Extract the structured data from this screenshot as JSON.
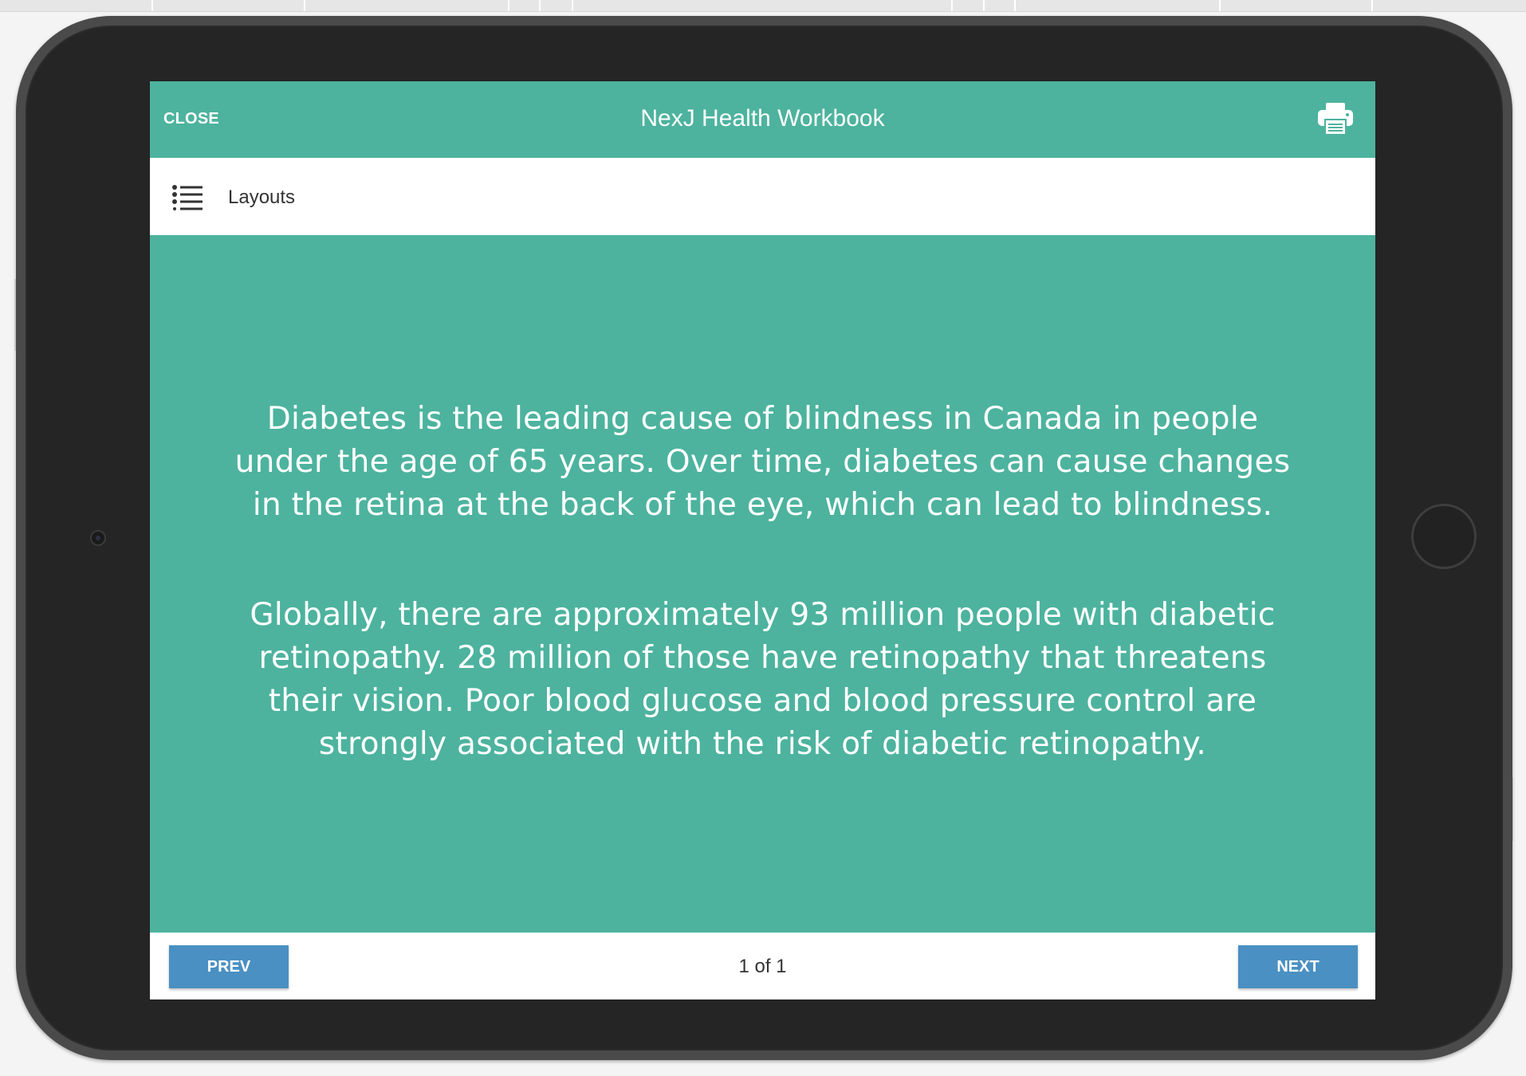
{
  "header": {
    "close_label": "CLOSE",
    "title": "NexJ Health Workbook",
    "print_icon": "printer-icon"
  },
  "subheader": {
    "menu_icon": "list-icon",
    "label": "Layouts"
  },
  "content": {
    "paragraph_1": "Diabetes is the leading cause of blindness in Canada in people under the age of 65 years. Over time, diabetes can cause changes in the retina at the back of the eye, which can lead to blindness.",
    "paragraph_2": "Globally, there are approximately 93 million people with diabetic retinopathy. 28 million of those have retinopathy that threatens their vision.  Poor blood glucose and blood pressure control are strongly associated with the risk of diabetic retinopathy."
  },
  "footer": {
    "prev_label": "PREV",
    "page_indicator": "1 of 1",
    "next_label": "NEXT"
  },
  "colors": {
    "accent": "#4db39e",
    "button": "#4a90c2",
    "device_frame": "#252525"
  }
}
